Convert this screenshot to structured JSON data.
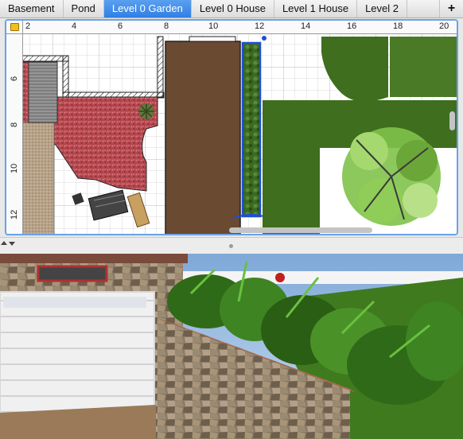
{
  "tabs": [
    {
      "label": "Basement",
      "active": false
    },
    {
      "label": "Pond",
      "active": false
    },
    {
      "label": "Level 0 Garden",
      "active": true
    },
    {
      "label": "Level 0 House",
      "active": false
    },
    {
      "label": "Level 1 House",
      "active": false
    },
    {
      "label": "Level 2",
      "active": false
    }
  ],
  "add_tab_icon": "plus-icon",
  "add_tab_glyph": "+",
  "plan": {
    "ruler_top_labels": [
      "2",
      "4",
      "6",
      "8",
      "10",
      "12",
      "14",
      "16",
      "18",
      "20"
    ],
    "ruler_left_labels": [
      "6",
      "8",
      "10",
      "12"
    ],
    "selected_item": "hedge-planter"
  },
  "colors": {
    "tab_active": "#2f7fe4",
    "selection": "#1d4fd6",
    "lawn": "#3f6e1e",
    "wood_floor": "#6b4a32",
    "brick_red": "#b4484e"
  }
}
